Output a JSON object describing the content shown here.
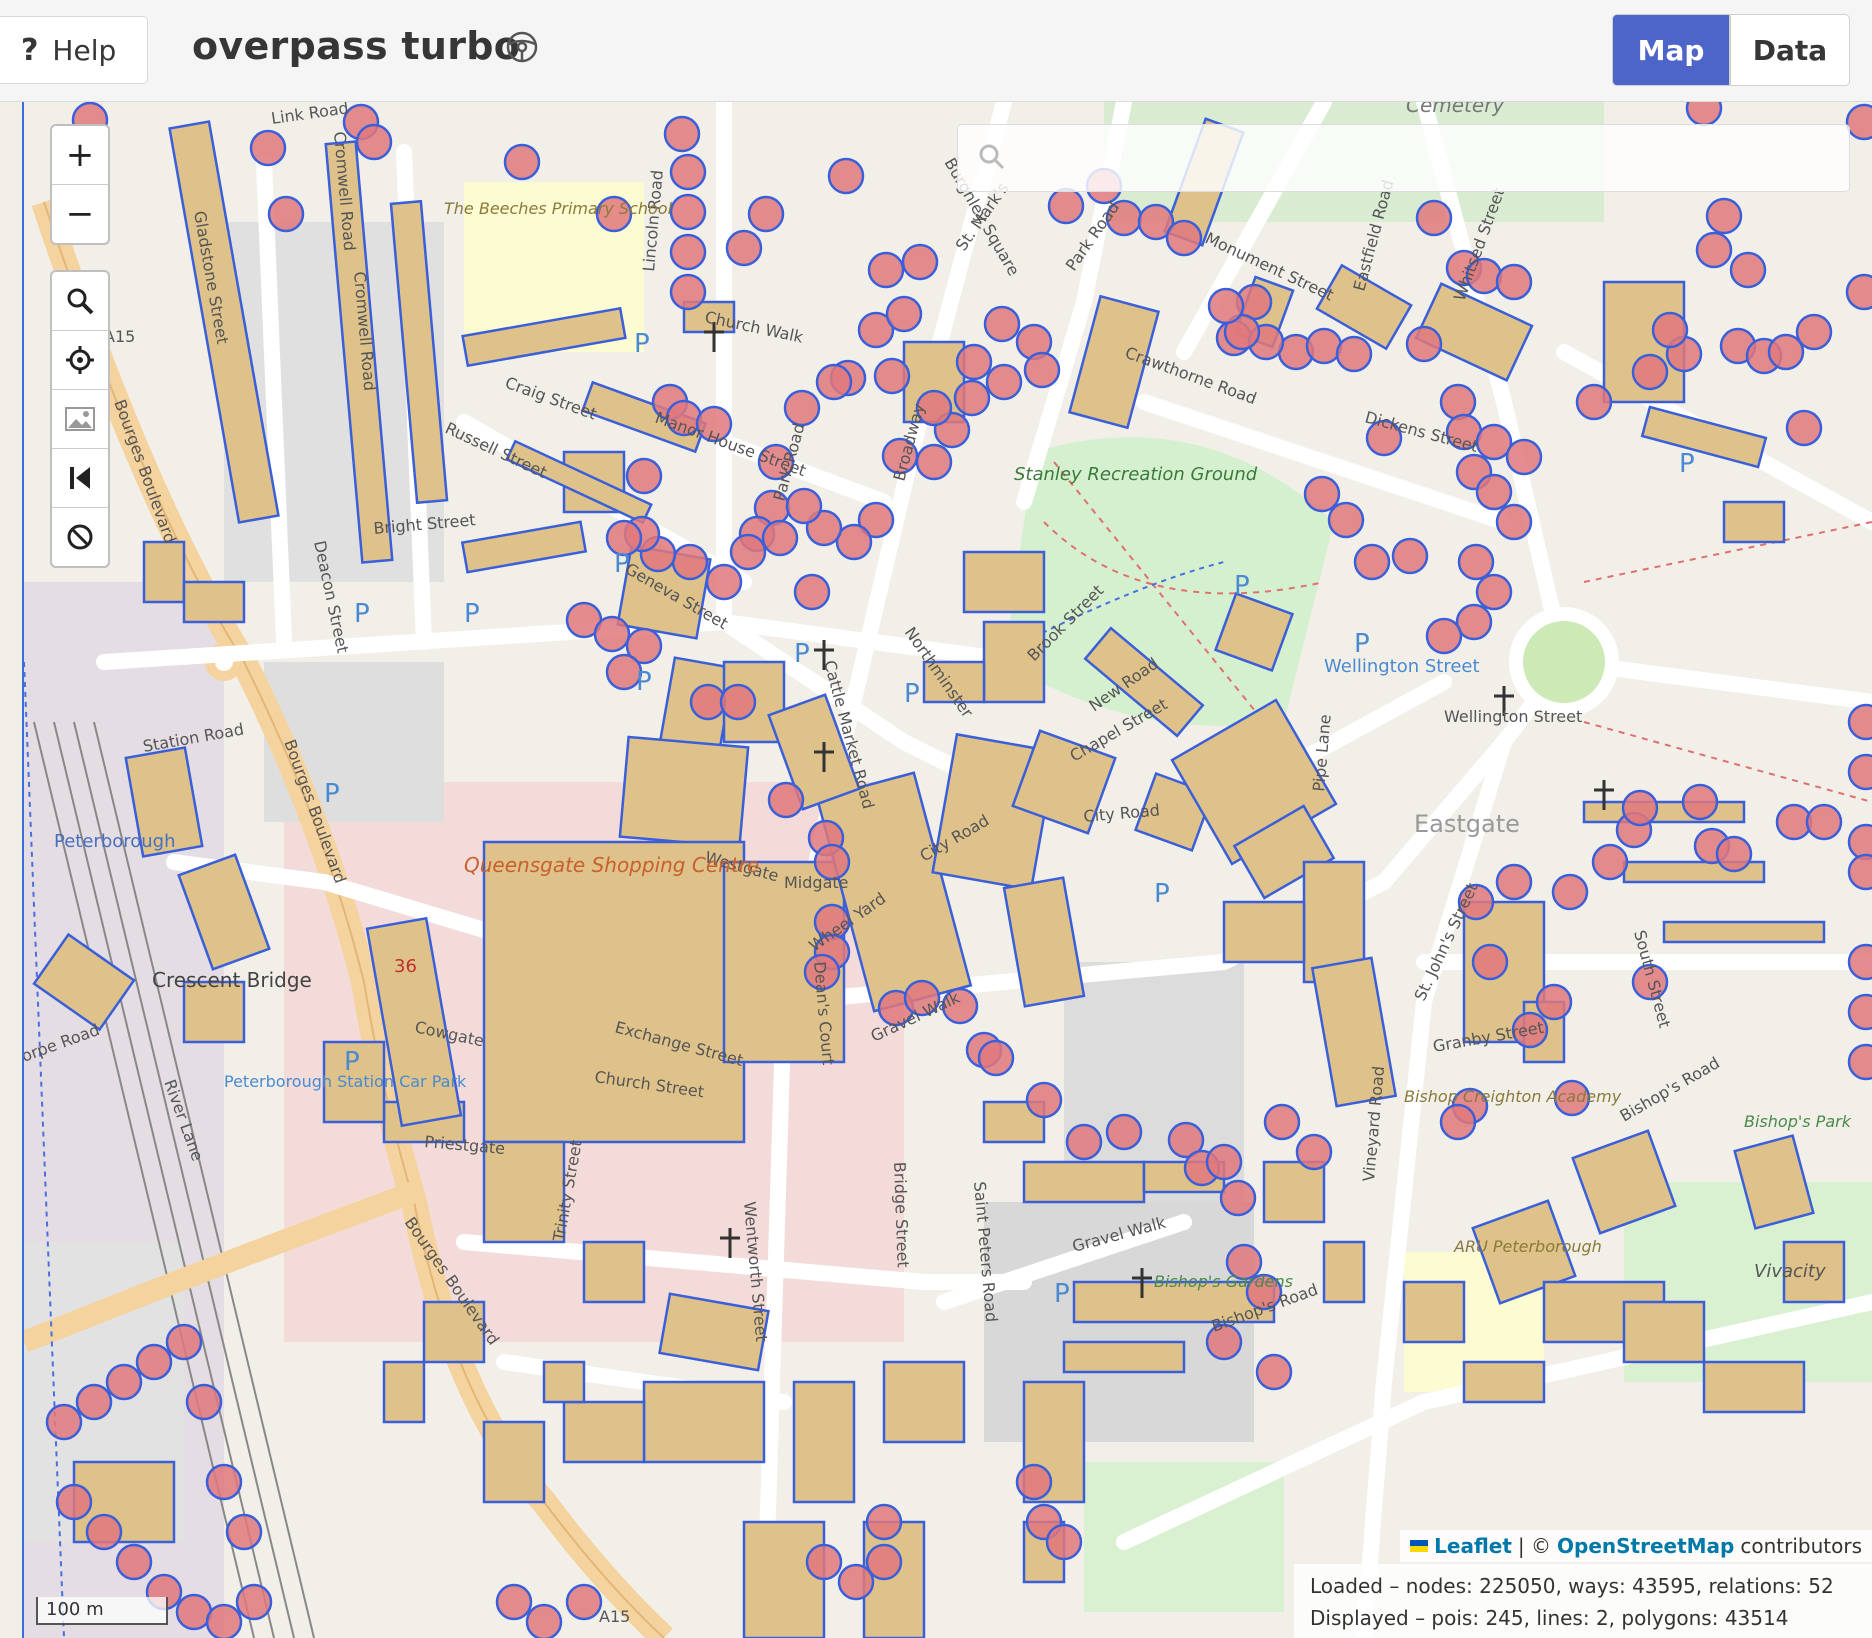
{
  "header": {
    "help_label": "Help",
    "help_icon": "question-mark-icon",
    "app_title": "overpass turbo",
    "title_icon": "steering-wheel-icon",
    "view_map": "Map",
    "view_data": "Data",
    "accent_color": "#4d65c9"
  },
  "map": {
    "controls": {
      "zoom_in": "+",
      "zoom_out": "−",
      "tools": [
        "search-icon",
        "locate-icon",
        "image-icon",
        "skip-back-icon",
        "clear-icon"
      ]
    },
    "search": {
      "placeholder": ""
    },
    "attribution": {
      "leaflet": "Leaflet",
      "sep": "| ©",
      "osm": "OpenStreetMap",
      "suffix": "contributors"
    },
    "stats": {
      "loaded": "Loaded – nodes: 225050, ways: 43595, relations: 52",
      "displayed": "Displayed – pois: 245, lines: 2, polygons: 43514"
    },
    "scale": "100 m",
    "labels": {
      "cemetery": "Cemetery",
      "link_road": "Link Road",
      "cromwell_road": "Cromwell Road",
      "gladstone_street": "Gladstone Street",
      "craig_street": "Craig Street",
      "russell_street": "Russell Street",
      "bright_street": "Bright Street",
      "deacon_street": "Deacon Street",
      "lincoln_road": "Lincoln Road",
      "church_walk": "Church Walk",
      "manor_house_street": "Manor House Street",
      "park_road": "Park Road",
      "broadway": "Broadway",
      "geneva_street": "Geneva Street",
      "beeches_school": "The Beeches Primary School",
      "stanley_ground": "Stanley Recreation Ground",
      "burghley_square": "Burghley Square",
      "monument_street": "Monument Street",
      "eastfield_road": "Eastfield Road",
      "crawthorne_road": "Crawthorne Road",
      "dickens_street": "Dickens Street",
      "whitsed_street": "Whitsed Street",
      "northminster": "Northminster",
      "brook_street": "Brook Street",
      "new_road": "New Road",
      "chapel_street": "Chapel Street",
      "wellington_street_car": "Wellington Street",
      "wellington_street": "Wellington Street",
      "pipe_lane": "Pipe Lane",
      "city_road": "City Road",
      "eastgate": "Eastgate",
      "cattle_market_road": "Cattle Market Road",
      "westgate": "Westgate",
      "midgate": "Midgate",
      "wheel_yard": "Wheel Yard",
      "queensgate": "Queensgate Shopping Centre",
      "bourges_boulevard": "Bourges Boulevard",
      "station_road": "Station Road",
      "peterborough": "Peterborough",
      "crescent_bridge": "Crescent Bridge",
      "thorpe_road": "orpe Road",
      "cowgate": "Cowgate",
      "exchange_street": "Exchange Street",
      "church_street": "Church Street",
      "priestgate": "Priestgate",
      "gravel_walk": "Gravel Walk",
      "deans_court": "Dean's Court",
      "granby_street": "Granby Street",
      "bishop_creighton": "Bishop Creighton Academy",
      "vineyard_road": "Vineyard Road",
      "st_johns_street": "St. John's Street",
      "bishops_road": "Bishop's Road",
      "bishops_park": "Bishop's Park",
      "bishops_gardens": "Bishop's Gardens",
      "aru": "ARU Peterborough",
      "vivacity": "Vivacity",
      "station_car_park": "Peterborough Station Car Park",
      "river_lane": "River Lane",
      "trinity_street": "Trinity Street",
      "wentworth_street": "Wentworth Street",
      "bridge_street": "Bridge Street",
      "saint_peters_road": "Saint Peters Road",
      "a15": "A15",
      "a15b": "A15",
      "route36": "36",
      "south_street": "South Street",
      "st_marks": "St. Mark's",
      "park_road_n": "Park Road"
    },
    "colors": {
      "building_fill": "#dec28a",
      "building_stroke": "#3a5fd9",
      "poi_fill": "#e0787c",
      "poi_stroke": "#3a5fd9",
      "road": "#ffffff",
      "primary_road": "#f5d39e",
      "park": "#c9eac0"
    }
  }
}
